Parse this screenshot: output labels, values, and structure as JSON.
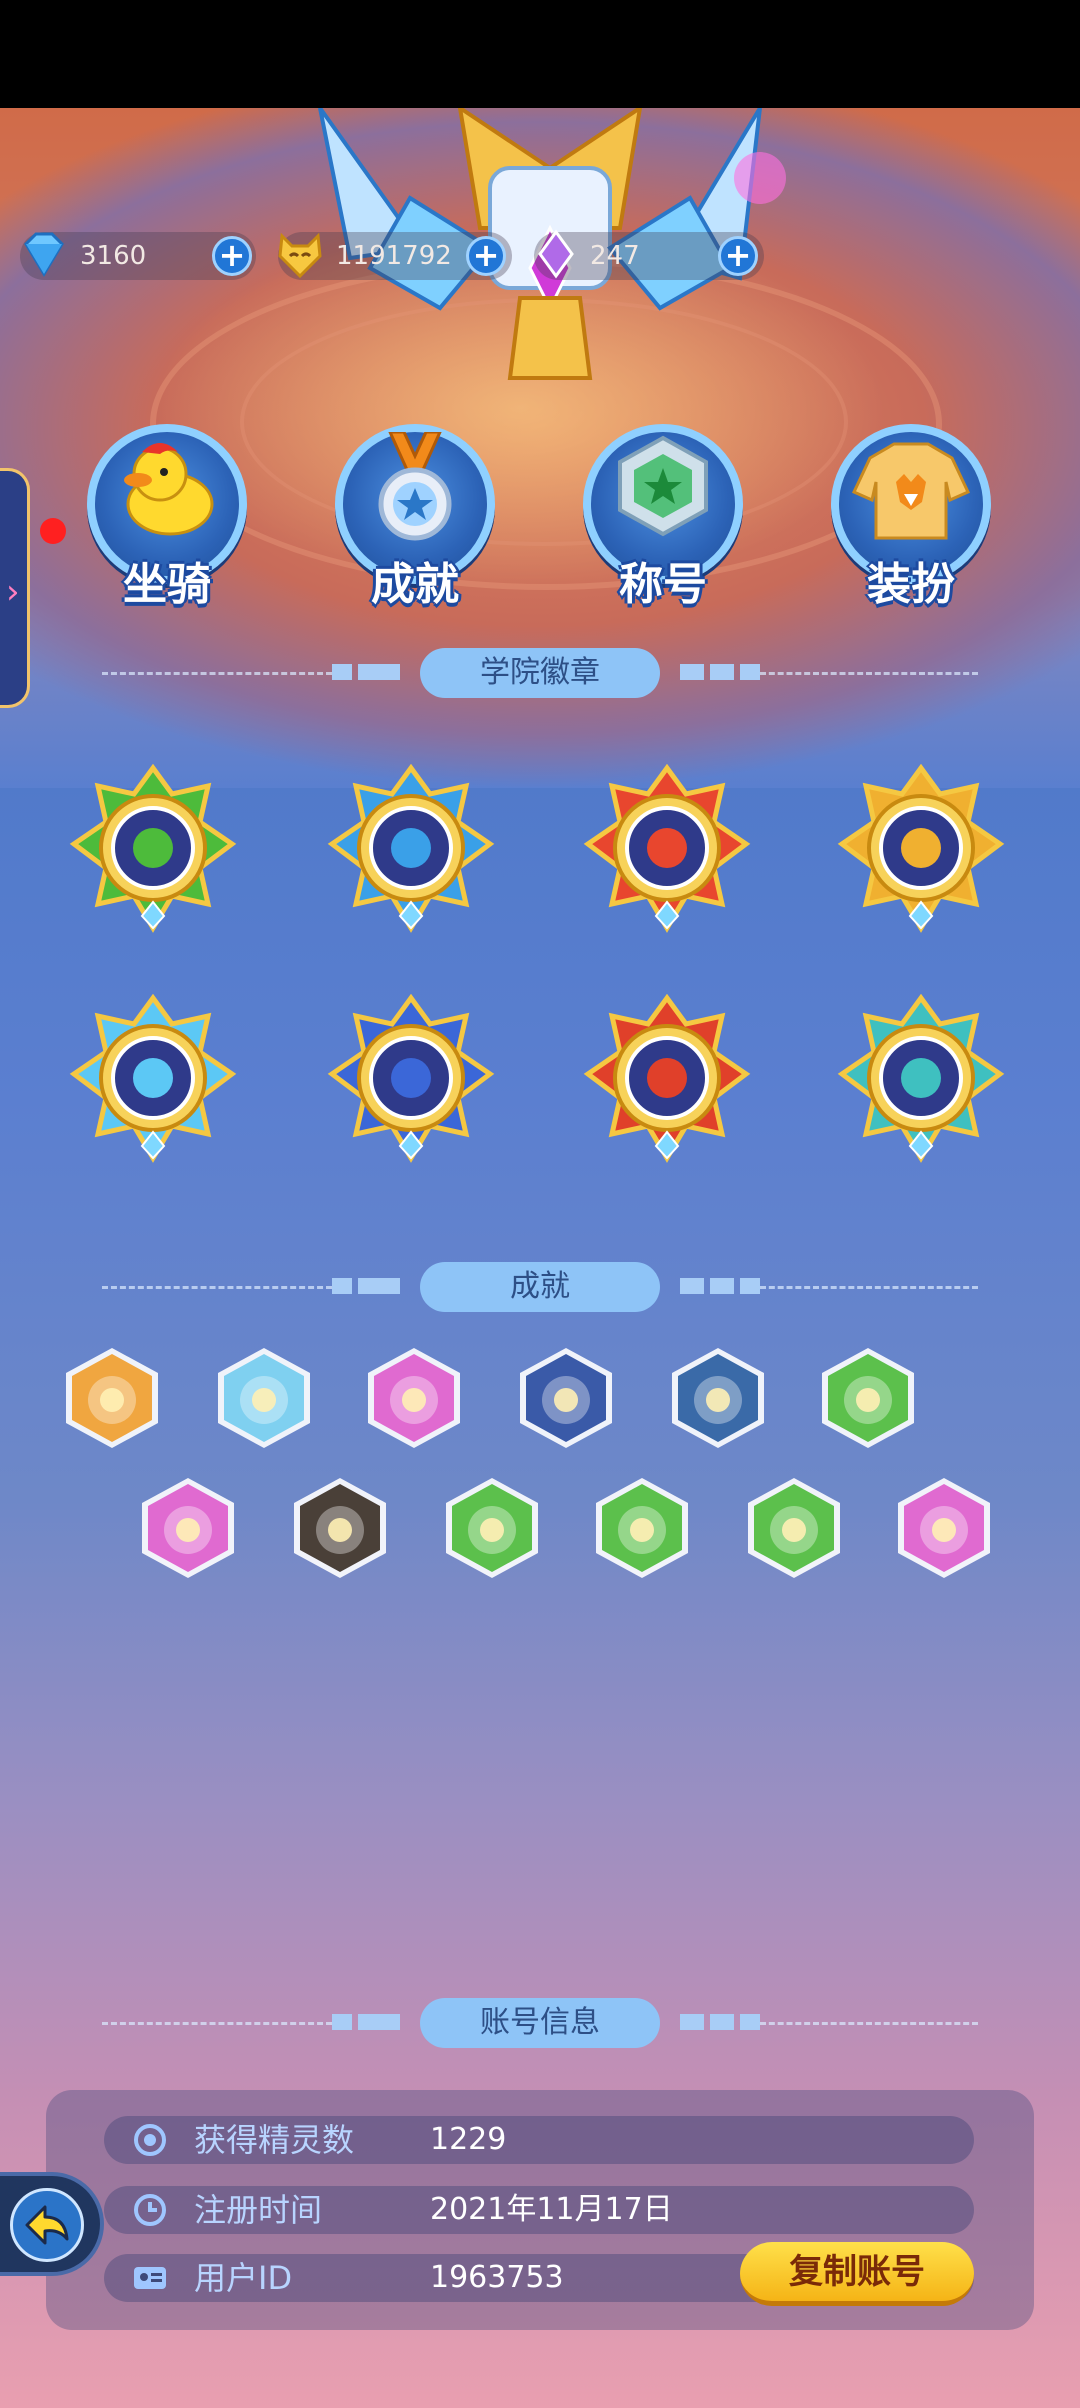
{
  "currency": [
    {
      "icon": "diamond-icon",
      "value": "3160"
    },
    {
      "icon": "cat-coin-icon",
      "value": "1191792"
    },
    {
      "icon": "energy-icon",
      "value": "247"
    }
  ],
  "features": [
    {
      "icon": "duck-mount-icon",
      "label": "坐骑"
    },
    {
      "icon": "medal-icon",
      "label": "成就"
    },
    {
      "icon": "title-badge-icon",
      "label": "称号"
    },
    {
      "icon": "fox-sweater-icon",
      "label": "装扮"
    }
  ],
  "sections": {
    "badges_title": "学院徽章",
    "achievements_title": "成就",
    "account_title": "账号信息"
  },
  "badges": [
    {
      "icon": "leaf-badge-icon",
      "color": "#4dbb3b"
    },
    {
      "icon": "wind-badge-icon",
      "color": "#3aa0e8"
    },
    {
      "icon": "fire-badge-icon",
      "color": "#e8462e"
    },
    {
      "icon": "earth-badge-icon",
      "color": "#f0b030"
    },
    {
      "icon": "ice-badge-icon",
      "color": "#5cc8f5"
    },
    {
      "icon": "thunder-badge-icon",
      "color": "#3b67d8"
    },
    {
      "icon": "flame-beast-badge-icon",
      "color": "#e0402a"
    },
    {
      "icon": "wing-badge-icon",
      "color": "#3fc0c0"
    }
  ],
  "achievements": [
    {
      "icon": "fox-achievement-icon",
      "color": "#f0a640"
    },
    {
      "icon": "star-laurel-achievement-icon",
      "color": "#7fd0f0"
    },
    {
      "icon": "dice-achievement-icon",
      "color": "#e06ad0"
    },
    {
      "icon": "monster-achievement-icon",
      "color": "#3a5aa8"
    },
    {
      "icon": "knight-achievement-icon",
      "color": "#3a6aa8"
    },
    {
      "icon": "bunny-achievement-icon",
      "color": "#5cc04c"
    },
    {
      "icon": "castle-achievement-icon",
      "color": "#e06ad0"
    },
    {
      "icon": "sword-achievement-icon",
      "color": "#4a4038"
    },
    {
      "icon": "fruit-achievement-icon",
      "color": "#5cc04c"
    },
    {
      "icon": "coin-achievement-icon",
      "color": "#5cc04c"
    },
    {
      "icon": "bandana-achievement-icon",
      "color": "#5cc04c"
    },
    {
      "icon": "laughing-achievement-icon",
      "color": "#e06ad0"
    }
  ],
  "account": {
    "rows": [
      {
        "icon": "spirit-icon",
        "label": "获得精灵数",
        "value": "1229"
      },
      {
        "icon": "clock-icon",
        "label": "注册时间",
        "value": "2021年11月17日"
      },
      {
        "icon": "id-card-icon",
        "label": "用户ID",
        "value": "1963753"
      }
    ],
    "copy_button": "复制账号"
  }
}
